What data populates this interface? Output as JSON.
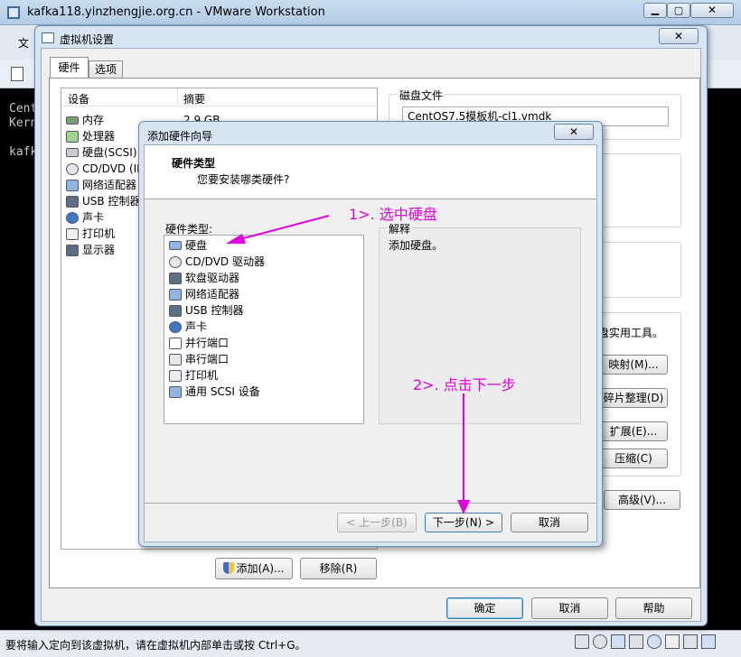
{
  "app": {
    "title": "kafka118.yinzhengjie.org.cn - VMware Workstation",
    "menu_first": "文",
    "console_lines": [
      "Cent",
      "Kern",
      "",
      "kafk"
    ],
    "status_text": "要将输入定向到该虚拟机，请在虚拟机内部单击或按 Ctrl+G。"
  },
  "vm_settings": {
    "title": "虚拟机设置",
    "tabs": [
      "硬件",
      "选项"
    ],
    "list_headers": [
      "设备",
      "摘要"
    ],
    "devices": [
      {
        "name": "内存",
        "icon": "memory-icon"
      },
      {
        "name": "处理器",
        "icon": "cpu-icon"
      },
      {
        "name": "硬盘(SCSI)",
        "icon": "hdd-icon"
      },
      {
        "name": "CD/DVD (ID",
        "icon": "cd-icon"
      },
      {
        "name": "网络适配器",
        "icon": "network-icon"
      },
      {
        "name": "USB 控制器",
        "icon": "usb-icon"
      },
      {
        "name": "声卡",
        "icon": "sound-icon"
      },
      {
        "name": "打印机",
        "icon": "printer-icon"
      },
      {
        "name": "显示器",
        "icon": "monitor-icon"
      }
    ],
    "memory_summary": "2.9 GB",
    "disk_file_label": "磁盘文件",
    "disk_file_value": "CentOS7.5模板机-cl1.vmdk",
    "utilities_text": "盘实用工具。",
    "map_button": "映射(M)...",
    "defrag_button": "碎片整理(D)",
    "expand_button": "扩展(E)...",
    "compact_button": "压缩(C)",
    "advanced_button": "高级(V)...",
    "add_button": "添加(A)...",
    "remove_button": "移除(R)",
    "ok_button": "确定",
    "cancel_button": "取消",
    "help_button": "帮助"
  },
  "wizard": {
    "title": "添加硬件向导",
    "heading": "硬件类型",
    "subheading": "您要安装哪类硬件?",
    "list_label": "硬件类型:",
    "types": [
      {
        "name": "硬盘",
        "icon": "hdd-icon"
      },
      {
        "name": "CD/DVD 驱动器",
        "icon": "cd-icon"
      },
      {
        "name": "软盘驱动器",
        "icon": "floppy-icon"
      },
      {
        "name": "网络适配器",
        "icon": "network-icon"
      },
      {
        "name": "USB 控制器",
        "icon": "usb-icon"
      },
      {
        "name": "声卡",
        "icon": "sound-icon"
      },
      {
        "name": "并行端口",
        "icon": "parallel-port-icon"
      },
      {
        "name": "串行端口",
        "icon": "serial-port-icon"
      },
      {
        "name": "打印机",
        "icon": "printer-icon"
      },
      {
        "name": "通用 SCSI 设备",
        "icon": "scsi-icon"
      }
    ],
    "explain_label": "解释",
    "explain_text": "添加硬盘。",
    "back_button": "< 上一步(B)",
    "next_button": "下一步(N) >",
    "cancel_button": "取消"
  },
  "annotations": {
    "step1": "1>. 选中硬盘",
    "step2": "2>. 点击下一步"
  }
}
